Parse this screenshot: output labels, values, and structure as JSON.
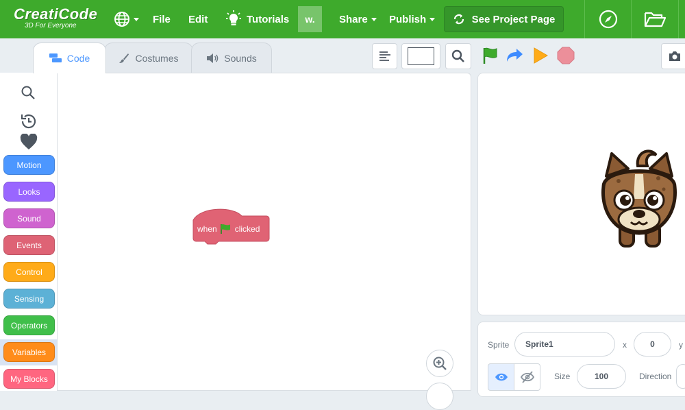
{
  "app": {
    "logo_name": "CreatiCode",
    "logo_tagline": "3D For Everyone"
  },
  "menu": {
    "file": "File",
    "edit": "Edit",
    "tutorials": "Tutorials",
    "user_initial": "w.",
    "share": "Share",
    "publish": "Publish",
    "see_project": "See Project Page"
  },
  "tabs": [
    {
      "label": "Code",
      "active": true
    },
    {
      "label": "Costumes",
      "active": false
    },
    {
      "label": "Sounds",
      "active": false
    }
  ],
  "categories": [
    {
      "label": "Motion",
      "color": "#4c97ff"
    },
    {
      "label": "Looks",
      "color": "#9966ff"
    },
    {
      "label": "Sound",
      "color": "#cf63cf"
    },
    {
      "label": "Events",
      "color": "#de6375"
    },
    {
      "label": "Control",
      "color": "#ffab19"
    },
    {
      "label": "Sensing",
      "color": "#5cb1d6"
    },
    {
      "label": "Operators",
      "color": "#40bf4a"
    },
    {
      "label": "Variables",
      "color": "#ff8c1a"
    },
    {
      "label": "My Blocks",
      "color": "#ff6680"
    }
  ],
  "block": {
    "when": "when",
    "clicked": "clicked",
    "color": "#e06374"
  },
  "sprite_info": {
    "sprite_label": "Sprite",
    "sprite_name": "Sprite1",
    "x_label": "x",
    "x_value": "0",
    "y_label": "y",
    "size_label": "Size",
    "size_value": "100",
    "direction_label": "Direction"
  },
  "colors": {
    "topbar": "#3eaa2c",
    "accent": "#4c97ff",
    "green_flag": "#3eaa2c",
    "go": "#ffab19",
    "stop": "#ec8f9a"
  }
}
